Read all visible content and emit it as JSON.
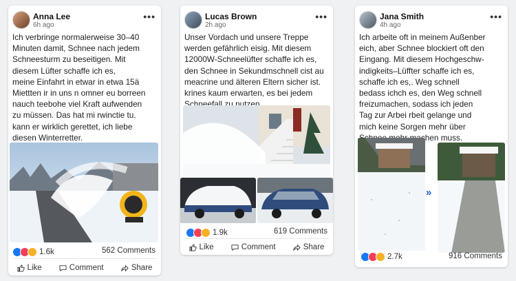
{
  "posts": [
    {
      "author": "Anna Lee",
      "time": "6h ago",
      "text": "Ich verbringe normalerweise 30–40\nMinuten damit, Schnee nach jedem\nSchneesturm zu beseitigen. Mit\ndiesem Lüfter schaffe ich es,\nmeine Einfahrt in etwar in etwa 15ä\nMiettten ir in uns n omner eu borreen\nnauch teebohe viel Kraft aufwenden\nzu müssen. Das hat mi rwinctie tu.\nkann er wirklich gerettet, ich liebe\ndiesen Winterretter.",
      "reactions": "1.6k",
      "comments": "562 Comments",
      "images": [
        "snow-blower-driveway"
      ]
    },
    {
      "author": "Lucas Brown",
      "time": "2h ago",
      "text": "Unser Vordach und unsere Treppe\nwerden gefährlich eisig. Mit diesem\n12000W-Schneelüfter schaffe ich es,\nden Schnee in Sekundmschnell cist au\nmeacrine und älteren Eltern sicher ist.\nkrines kaum erwarten, es bei jedem\nSchneefall zu nutzen.",
      "reactions": "1.9k",
      "comments": "619 Comments",
      "images": [
        "porch-stairs",
        "car-snow-covered",
        "car-cleared"
      ]
    },
    {
      "author": "Jana Smith",
      "time": "4h ago",
      "text": "Ich arbeite oft in meinem Außenber\neich, aber Schnee blockiert oft den\nEingang. Mit diesem Hochgeschw-\nindigkeits–Lüffter schaffe ich es,\nschaffe ich es,. Weg schnell\nbedass ichch es, den Weg schnell\nfreizumachen, sodass ich jeden\nTag zur Arbei rbeit gelange und\nmich keine Sorgen mehr über\nSchnee mehr machen muss.",
      "reactions": "2.7k",
      "comments": "916 Comments",
      "images": [
        "driveway-before",
        "driveway-after"
      ]
    }
  ],
  "actions": {
    "like": "Like",
    "comment": "Comment",
    "share": "Share"
  },
  "icons": {
    "menu": "more-dots-icon",
    "like": "thumb-up-icon",
    "comment": "speech-bubble-icon",
    "share": "share-arrow-icon",
    "arrow": "double-chevron-right-icon"
  },
  "colors": {
    "like": "#1877f2",
    "love": "#f33e58",
    "haha": "#f7b125",
    "arrow": "#1a5fd6"
  }
}
